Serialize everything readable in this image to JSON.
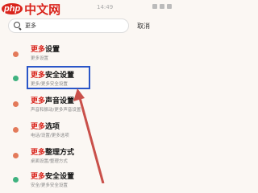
{
  "watermark": {
    "badge": "php",
    "text": "中文网"
  },
  "status_time": "14:49",
  "search": {
    "value": "更多",
    "cancel_label": "取消"
  },
  "results": [
    {
      "title_hl": "更多",
      "title_rest": "设置",
      "subtitle": "更多设置"
    },
    {
      "title_hl": "更多",
      "title_rest": "安全设置",
      "subtitle": "更多/更多安全设置"
    },
    {
      "title_hl": "更多",
      "title_rest": "声音设置",
      "subtitle": "声音和振动/更多声音设置"
    },
    {
      "title_hl": "更多",
      "title_rest": "选项",
      "subtitle": "电话/设置/更多选项"
    },
    {
      "title_hl": "更多",
      "title_rest": "整理方式",
      "subtitle": "桌面设置/整理方式"
    },
    {
      "title_hl": "更多",
      "title_rest": "安全设置",
      "subtitle": "安全/更多安全设置"
    }
  ],
  "colors": {
    "accent": "#d9241c",
    "highlight": "#2a56c8",
    "arrow": "#c9504a"
  },
  "icons": [
    "settings-icon",
    "shield-icon",
    "sound-icon",
    "phone-icon",
    "desktop-icon",
    "shield-icon"
  ]
}
